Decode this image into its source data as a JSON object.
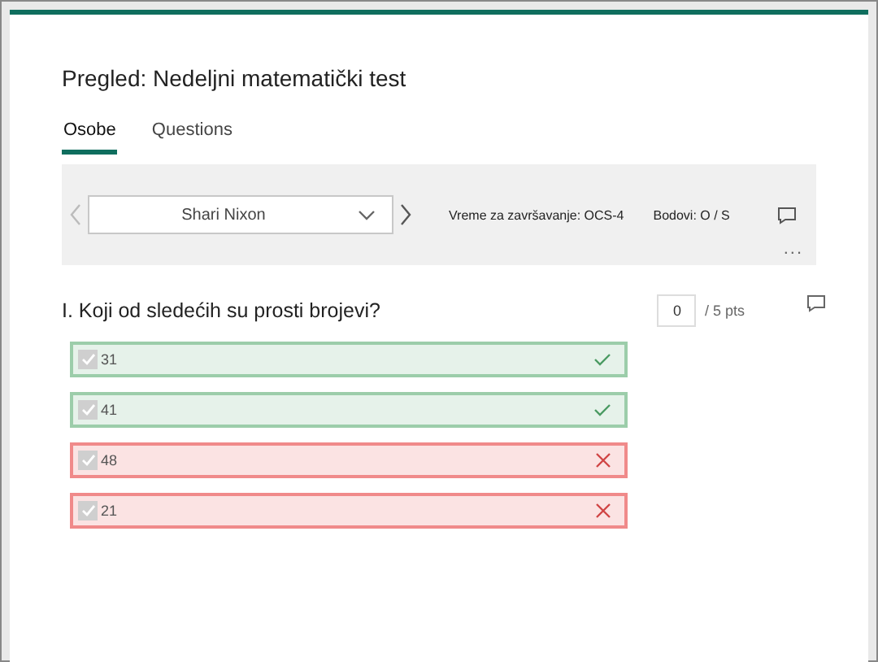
{
  "title": "Pregled: Nedeljni matematički test",
  "tabs": [
    {
      "label": "Osobe",
      "selected": true
    },
    {
      "label": "Questions",
      "selected": false
    }
  ],
  "respondent": {
    "name": "Shari Nixon",
    "time": "Vreme za završavanje: OCS-4",
    "points": "Bodovi: O / S",
    "more": "..."
  },
  "question": {
    "text": "I. Koji od sledećih su prosti brojevi?",
    "score": "0",
    "max": "/ 5 pts",
    "options": [
      {
        "label": "31",
        "checked": true,
        "correct": true
      },
      {
        "label": "41",
        "checked": true,
        "correct": true
      },
      {
        "label": "48",
        "checked": true,
        "correct": false
      },
      {
        "label": "21",
        "checked": true,
        "correct": false
      }
    ]
  }
}
